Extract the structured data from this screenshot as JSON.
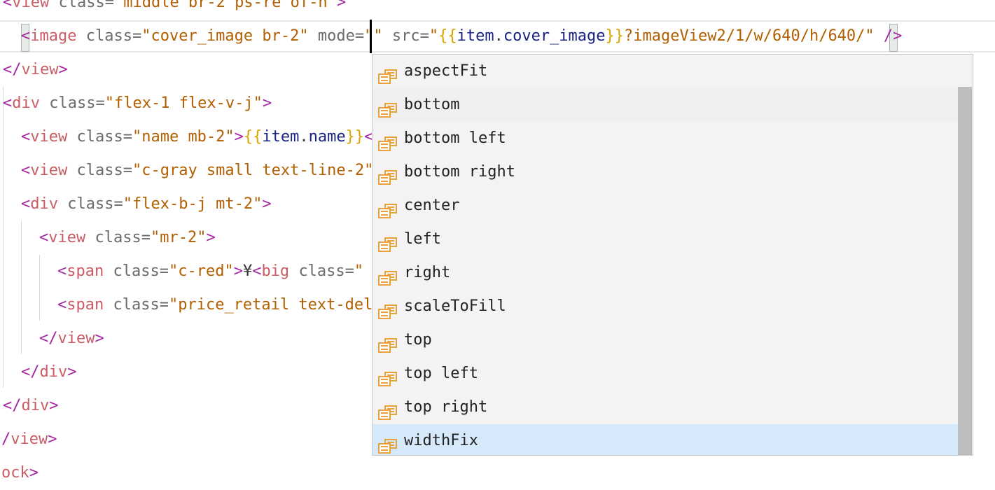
{
  "editor": {
    "lines": [
      [
        [
          "t-br",
          "<"
        ],
        [
          "t-tag",
          "view"
        ],
        [
          "t-plain",
          " "
        ],
        [
          "t-attr",
          "class="
        ],
        [
          "t-str",
          "\"middle br-2 ps-re of-h\""
        ],
        [
          "t-br",
          ">"
        ]
      ],
      [
        [
          "t-br",
          "<"
        ],
        [
          "t-tag",
          "image"
        ],
        [
          "t-plain",
          " "
        ],
        [
          "t-attr",
          "class="
        ],
        [
          "t-str",
          "\"cover_image br-2\""
        ],
        [
          "t-plain",
          " "
        ],
        [
          "t-attr",
          "mode="
        ],
        [
          "t-str",
          "\""
        ],
        [
          "t-str",
          "\""
        ],
        [
          "t-plain",
          " "
        ],
        [
          "t-attr",
          "src="
        ],
        [
          "t-str",
          "\""
        ],
        [
          "t-mus",
          "{{"
        ],
        [
          "t-var",
          "item"
        ],
        [
          "t-plain",
          "."
        ],
        [
          "t-var",
          "cover_image"
        ],
        [
          "t-mus",
          "}}"
        ],
        [
          "t-str",
          "?imageView2/1/w/640/h/640/\""
        ],
        [
          "t-plain",
          " "
        ],
        [
          "t-br",
          "/"
        ],
        [
          "t-br",
          ">"
        ]
      ],
      [
        [
          "t-br",
          "</"
        ],
        [
          "t-tag",
          "view"
        ],
        [
          "t-br",
          ">"
        ]
      ],
      [
        [
          "t-br",
          "<"
        ],
        [
          "t-tag",
          "div"
        ],
        [
          "t-plain",
          " "
        ],
        [
          "t-attr",
          "class="
        ],
        [
          "t-str",
          "\"flex-1 flex-v-j\""
        ],
        [
          "t-br",
          ">"
        ]
      ],
      [
        [
          "t-br",
          "<"
        ],
        [
          "t-tag",
          "view"
        ],
        [
          "t-plain",
          " "
        ],
        [
          "t-attr",
          "class="
        ],
        [
          "t-str",
          "\"name mb-2\""
        ],
        [
          "t-br",
          ">"
        ],
        [
          "t-mus",
          "{{"
        ],
        [
          "t-var",
          "item"
        ],
        [
          "t-plain",
          "."
        ],
        [
          "t-var",
          "name"
        ],
        [
          "t-mus",
          "}}"
        ],
        [
          "t-br",
          "<"
        ]
      ],
      [
        [
          "t-br",
          "<"
        ],
        [
          "t-tag",
          "view"
        ],
        [
          "t-plain",
          " "
        ],
        [
          "t-attr",
          "class="
        ],
        [
          "t-str",
          "\"c-gray small text-line-2\""
        ]
      ],
      [
        [
          "t-br",
          "<"
        ],
        [
          "t-tag",
          "div"
        ],
        [
          "t-plain",
          " "
        ],
        [
          "t-attr",
          "class="
        ],
        [
          "t-str",
          "\"flex-b-j mt-2\""
        ],
        [
          "t-br",
          ">"
        ]
      ],
      [
        [
          "t-br",
          "<"
        ],
        [
          "t-tag",
          "view"
        ],
        [
          "t-plain",
          " "
        ],
        [
          "t-attr",
          "class="
        ],
        [
          "t-str",
          "\"mr-2\""
        ],
        [
          "t-br",
          ">"
        ]
      ],
      [
        [
          "t-br",
          "<"
        ],
        [
          "t-tag",
          "span"
        ],
        [
          "t-plain",
          " "
        ],
        [
          "t-attr",
          "class="
        ],
        [
          "t-str",
          "\"c-red\""
        ],
        [
          "t-br",
          ">"
        ],
        [
          "t-plain",
          "¥"
        ],
        [
          "t-br",
          "<"
        ],
        [
          "t-tag",
          "big"
        ],
        [
          "t-plain",
          " "
        ],
        [
          "t-attr",
          "class="
        ],
        [
          "t-str",
          "\""
        ]
      ],
      [
        [
          "t-br",
          "<"
        ],
        [
          "t-tag",
          "span"
        ],
        [
          "t-plain",
          " "
        ],
        [
          "t-attr",
          "class="
        ],
        [
          "t-str",
          "\"price_retail text-del"
        ]
      ],
      [
        [
          "t-br",
          "</"
        ],
        [
          "t-tag",
          "view"
        ],
        [
          "t-br",
          ">"
        ]
      ],
      [
        [
          "t-br",
          "</"
        ],
        [
          "t-tag",
          "div"
        ],
        [
          "t-br",
          ">"
        ]
      ],
      [
        [
          "t-br",
          "</"
        ],
        [
          "t-tag",
          "div"
        ],
        [
          "t-br",
          ">"
        ]
      ],
      [
        [
          "t-br",
          "/"
        ],
        [
          "t-tag",
          "view"
        ],
        [
          "t-br",
          ">"
        ]
      ],
      [
        [
          "t-tag",
          "ock"
        ],
        [
          "t-br",
          ">"
        ]
      ]
    ]
  },
  "autocomplete": {
    "items": [
      {
        "label": "aspectFit",
        "icon": "snippet-icon"
      },
      {
        "label": "bottom",
        "icon": "snippet-icon"
      },
      {
        "label": "bottom left",
        "icon": "snippet-icon"
      },
      {
        "label": "bottom right",
        "icon": "snippet-icon"
      },
      {
        "label": "center",
        "icon": "snippet-icon"
      },
      {
        "label": "left",
        "icon": "snippet-icon"
      },
      {
        "label": "right",
        "icon": "snippet-icon"
      },
      {
        "label": "scaleToFill",
        "icon": "snippet-icon"
      },
      {
        "label": "top",
        "icon": "snippet-icon"
      },
      {
        "label": "top left",
        "icon": "snippet-icon"
      },
      {
        "label": "top right",
        "icon": "snippet-icon"
      },
      {
        "label": "widthFix",
        "icon": "snippet-icon"
      }
    ],
    "selected_label": "widthFix",
    "hovered_label": "bottom"
  },
  "colors": {
    "selection": "#d6e9fb",
    "icon": "#e8a23b"
  }
}
